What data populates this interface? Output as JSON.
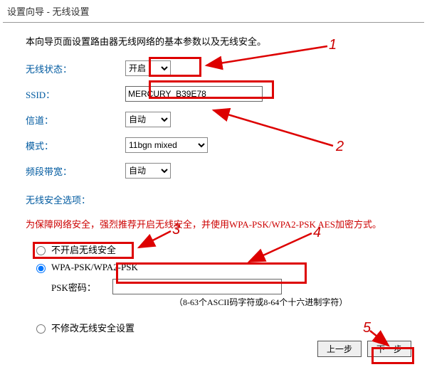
{
  "window_title": "设置向导 - 无线设置",
  "intro_text": "本向导页面设置路由器无线网络的基本参数以及无线安全。",
  "fields": {
    "wireless_state": {
      "label": "无线状态：",
      "value": "开启"
    },
    "ssid": {
      "label": "SSID：",
      "value": "MERCURY_B39E78"
    },
    "channel": {
      "label": "信道：",
      "value": "自动"
    },
    "mode": {
      "label": "模式：",
      "value": "11bgn mixed"
    },
    "bandwidth": {
      "label": "频段带宽：",
      "value": "自动"
    }
  },
  "security": {
    "heading": "无线安全选项：",
    "warning": "为保障网络安全，强烈推荐开启无线安全，并使用WPA-PSK/WPA2-PSK AES加密方式。",
    "options": {
      "open": "不开启无线安全",
      "wpa": "WPA-PSK/WPA2-PSK",
      "nochg": "不修改无线安全设置"
    },
    "psk_label": "PSK密码：",
    "psk_value": "",
    "psk_hint": "（8-63个ASCII码字符或8-64个十六进制字符）"
  },
  "buttons": {
    "prev": "上一步",
    "next": "下一步"
  },
  "callouts": {
    "c1": "1",
    "c2": "2",
    "c3": "3",
    "c4": "4",
    "c5": "5"
  }
}
